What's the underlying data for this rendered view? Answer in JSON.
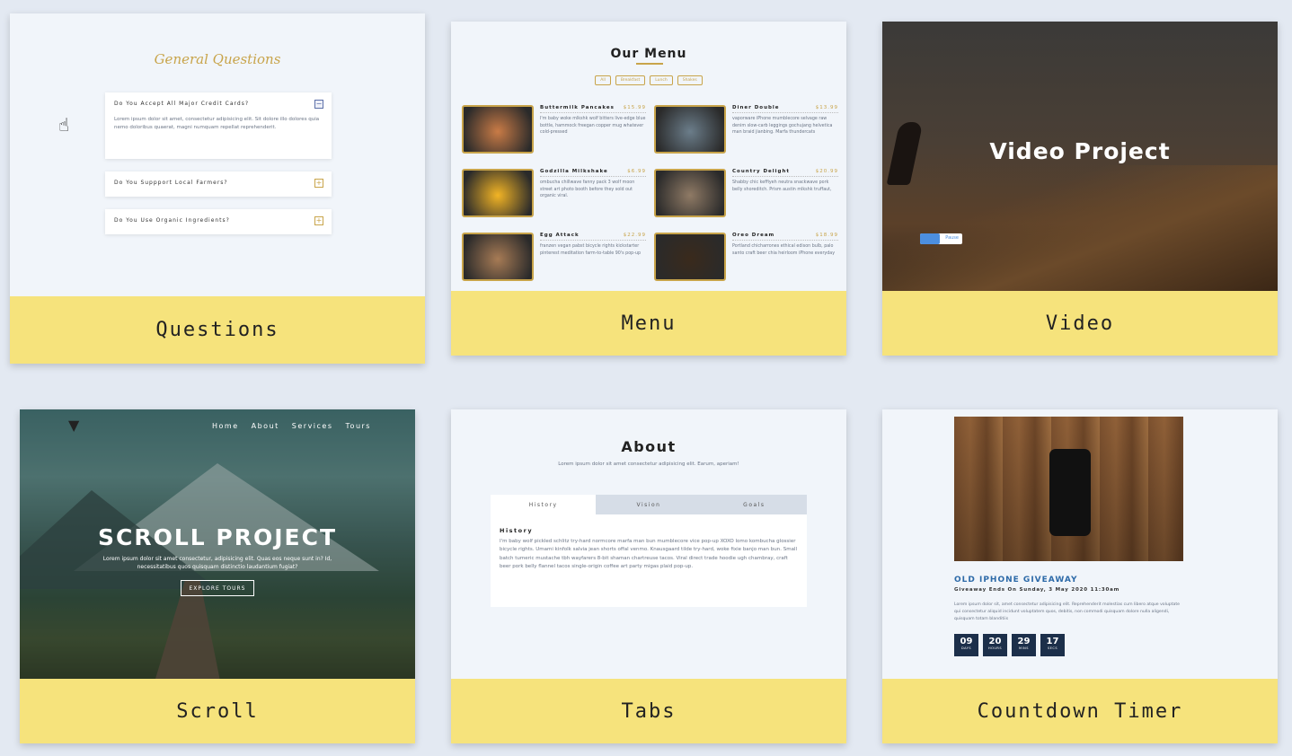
{
  "cards": {
    "questions": {
      "label": "Questions",
      "title": "General Questions",
      "items": [
        {
          "q": "Do You Accept All Major Credit Cards?",
          "a": "Lorem ipsum dolor sit amet, consectetur adipisicing elit. Sit dolore illo dolores quia nemo doloribus quaerat, magni numquam repellat reprehenderit.",
          "open": true
        },
        {
          "q": "Do You Suppport Local Farmers?",
          "open": false
        },
        {
          "q": "Do You Use Organic Ingredients?",
          "open": false
        }
      ]
    },
    "menu": {
      "label": "Menu",
      "title": "Our Menu",
      "filters": [
        "All",
        "Breakfast",
        "Lunch",
        "Shakes"
      ],
      "items": [
        {
          "name": "Buttermilk Pancakes",
          "price": "$15.99",
          "desc": "I'm baby woke mlkshk wolf bitters live-edge blue bottle, hammock freegan copper mug whatever cold-pressed",
          "color": "#c97b46"
        },
        {
          "name": "Diner Double",
          "price": "$13.99",
          "desc": "vaporware iPhone mumblecore selvage raw denim slow-carb leggings gochujang helvetica man braid jianbing. Marfa thundercats",
          "color": "#6b7d8a"
        },
        {
          "name": "Godzilla Milkshake",
          "price": "$6.99",
          "desc": "ombucha chillwave fanny pack 3 wolf moon street art photo booth before they sold out organic viral.",
          "color": "#f2b425"
        },
        {
          "name": "Country Delight",
          "price": "$20.99",
          "desc": "Shabby chic keffiyeh neutra snackwave pork belly shoreditch. Prism austin mlkshk truffaut,",
          "color": "#8f7a65"
        },
        {
          "name": "Egg Attack",
          "price": "$22.99",
          "desc": "franzen vegan pabst bicycle rights kickstarter pinterest meditation farm-to-table 90's pop-up",
          "color": "#a77b55"
        },
        {
          "name": "Oreo Dream",
          "price": "$18.99",
          "desc": "Portland chicharrones ethical edison bulb, palo santo craft beer chia heirloom iPhone everyday",
          "color": "#3a2a1c"
        }
      ]
    },
    "video": {
      "label": "Video",
      "title": "Video Project",
      "toggle": "Pause"
    },
    "scroll": {
      "label": "Scroll",
      "logo": "▼",
      "nav": [
        "Home",
        "About",
        "Services",
        "Tours"
      ],
      "title": "SCROLL PROJECT",
      "subtitle": "Lorem ipsum dolor sit amet consectetur, adipisicing elit. Quas eos neque sunt in? Id, necessitatibus quos quisquam distinctio laudantium fugiat?",
      "button": "EXPLORE TOURS"
    },
    "tabs": {
      "label": "Tabs",
      "title": "About",
      "subtitle": "Lorem ipsum dolor sit amet consectetur adipisicing elit. Earum, aperiam!",
      "tabs": [
        "History",
        "Vision",
        "Goals"
      ],
      "active_heading": "History",
      "active_text": "I'm baby wolf pickled schlitz try-hard normcore marfa man bun mumblecore vice pop-up XOXO lomo kombucha glossier bicycle rights. Umami kinfolk salvia jean shorts offal venmo. Knausgaard tilde try-hard, woke fixie banjo man bun. Small batch tumeric mustache tbh wayfarers 8-bit shaman chartreuse tacos. Viral direct trade hoodie ugh chambray, craft beer pork belly flannel tacos single-origin coffee art party migas plaid pop-up."
    },
    "countdown": {
      "label": "Countdown Timer",
      "title": "OLD IPHONE GIVEAWAY",
      "date": "Giveaway Ends On Sunday, 3 May 2020 11:30am",
      "body": "Lorem ipsum dolor sit, amet consectetur adipisicing elit. Reprehenderit molestias cum libero atque voluptate qui consectetur aliquid incidunt voluptatem quos, debitis, non commodi quisquam dolore nulla aligendi, quisquam totam blanditiis",
      "timer": [
        {
          "n": "09",
          "l": "DAYS"
        },
        {
          "n": "20",
          "l": "HOURS"
        },
        {
          "n": "29",
          "l": "MINS"
        },
        {
          "n": "17",
          "l": "SECS"
        }
      ],
      "apple": ""
    }
  }
}
